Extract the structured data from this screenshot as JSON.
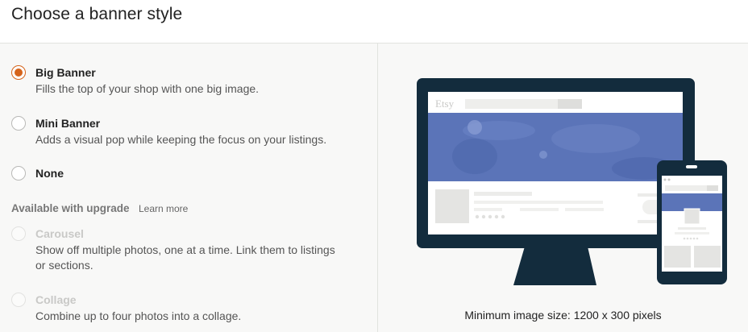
{
  "header": {
    "title": "Choose a banner style"
  },
  "options": [
    {
      "label": "Big Banner",
      "description": "Fills the top of your shop with one big image.",
      "selected": true,
      "disabled": false
    },
    {
      "label": "Mini Banner",
      "description": "Adds a visual pop while keeping the focus on your listings.",
      "selected": false,
      "disabled": false
    },
    {
      "label": "None",
      "description": "",
      "selected": false,
      "disabled": false
    }
  ],
  "upgrade": {
    "label": "Available with upgrade",
    "learn_more": "Learn more",
    "options": [
      {
        "label": "Carousel",
        "description": "Show off multiple photos, one at a time. Link them to listings or sections.",
        "disabled": true
      },
      {
        "label": "Collage",
        "description": "Combine up to four photos into a collage.",
        "disabled": true
      }
    ]
  },
  "preview": {
    "logo_text": "Etsy",
    "caption": "Minimum image size: 1200 x 300 pixels"
  },
  "colors": {
    "accent": "#d5641c",
    "device_frame": "#132c3d",
    "banner": "#5b74b8"
  }
}
